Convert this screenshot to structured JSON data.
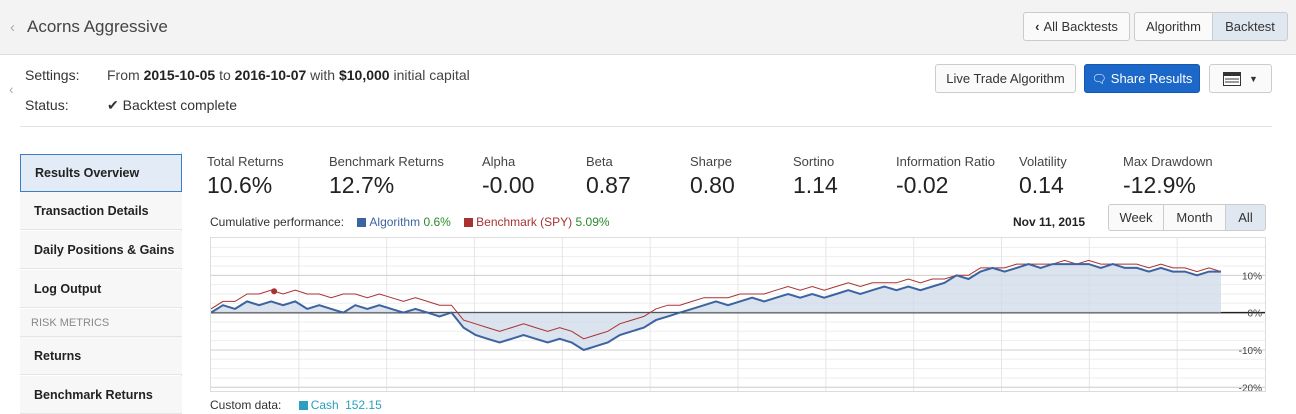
{
  "header": {
    "title": "Acorns Aggressive",
    "all_backtests": "All Backtests",
    "tab_algorithm": "Algorithm",
    "tab_backtest": "Backtest"
  },
  "settings": {
    "settings_label": "Settings:",
    "from_word": "From",
    "start_date": "2015-10-05",
    "to_word": "to",
    "end_date": "2016-10-07",
    "with_word": "with",
    "capital": "$10,000",
    "capital_suffix": "initial capital",
    "status_label": "Status:",
    "status_value": "Backtest complete"
  },
  "actions": {
    "live_trade": "Live Trade Algorithm",
    "share": "Share Results"
  },
  "sidebar": {
    "items": [
      {
        "label": "Results Overview",
        "active": true
      },
      {
        "label": "Transaction Details"
      },
      {
        "label": "Daily Positions & Gains"
      },
      {
        "label": "Log Output"
      }
    ],
    "risk_header": "RISK METRICS",
    "risk_items": [
      {
        "label": "Returns"
      },
      {
        "label": "Benchmark Returns"
      }
    ]
  },
  "metrics": [
    {
      "label": "Total Returns",
      "value": "10.6%"
    },
    {
      "label": "Benchmark Returns",
      "value": "12.7%"
    },
    {
      "label": "Alpha",
      "value": "-0.00"
    },
    {
      "label": "Beta",
      "value": "0.87"
    },
    {
      "label": "Sharpe",
      "value": "0.80"
    },
    {
      "label": "Sortino",
      "value": "1.14"
    },
    {
      "label": "Information Ratio",
      "value": "-0.02"
    },
    {
      "label": "Volatility",
      "value": "0.14"
    },
    {
      "label": "Max Drawdown",
      "value": "-12.9%"
    }
  ],
  "performance": {
    "label": "Cumulative performance:",
    "algo_name": "Algorithm",
    "algo_value": "0.6%",
    "bench_name": "Benchmark (SPY)",
    "bench_value": "5.09%",
    "hover_date": "Nov 11, 2015",
    "range_week": "Week",
    "range_month": "Month",
    "range_all": "All",
    "colors": {
      "algo": "#3c64a0",
      "bench": "#a83232",
      "fill": "#cfd9e8",
      "cash": "#2a9fbf"
    }
  },
  "chart_data": {
    "type": "line",
    "ytick_labels": [
      "10%",
      "0%",
      "-10%",
      "-20%"
    ],
    "yticks": [
      10,
      0,
      -10,
      -20
    ],
    "ylim": [
      -21,
      20
    ],
    "series": [
      {
        "name": "Algorithm",
        "values": [
          0,
          2,
          1,
          3,
          2,
          3,
          2,
          3,
          1,
          2,
          1,
          0,
          2,
          1,
          2,
          1,
          0,
          1,
          0,
          -1,
          0,
          -4,
          -6,
          -7,
          -8,
          -7,
          -6,
          -7,
          -8,
          -7,
          -8,
          -10,
          -9,
          -8,
          -6,
          -5,
          -4,
          -2,
          -1,
          0,
          1,
          2,
          3,
          2,
          3,
          4,
          3,
          4,
          5,
          4,
          5,
          4,
          5,
          6,
          5,
          6,
          7,
          6,
          7,
          6,
          7,
          8,
          10,
          9,
          11,
          12,
          11,
          12,
          13,
          12,
          13,
          13,
          13,
          13,
          12,
          13,
          12,
          12,
          11,
          12,
          11,
          11,
          10,
          11,
          11
        ]
      },
      {
        "name": "Benchmark (SPY)",
        "values": [
          1,
          3,
          3,
          5,
          5,
          6,
          5,
          6,
          5,
          5,
          4,
          5,
          5,
          4,
          5,
          4,
          3,
          4,
          3,
          2,
          2,
          -2,
          -3,
          -4,
          -5,
          -4,
          -3,
          -4,
          -5,
          -4,
          -5,
          -7,
          -6,
          -5,
          -3,
          -2,
          -1,
          1,
          2,
          2,
          3,
          4,
          4,
          4,
          5,
          5,
          5,
          6,
          7,
          6,
          7,
          6,
          7,
          8,
          7,
          8,
          8,
          8,
          9,
          8,
          9,
          9,
          10,
          10,
          12,
          12,
          12,
          13,
          13,
          13,
          13,
          14,
          13,
          14,
          13,
          13,
          13,
          13,
          12,
          13,
          12,
          12,
          11,
          12,
          11
        ]
      }
    ]
  },
  "custom_data": {
    "label": "Custom data:",
    "name": "Cash",
    "value": "152.15"
  }
}
